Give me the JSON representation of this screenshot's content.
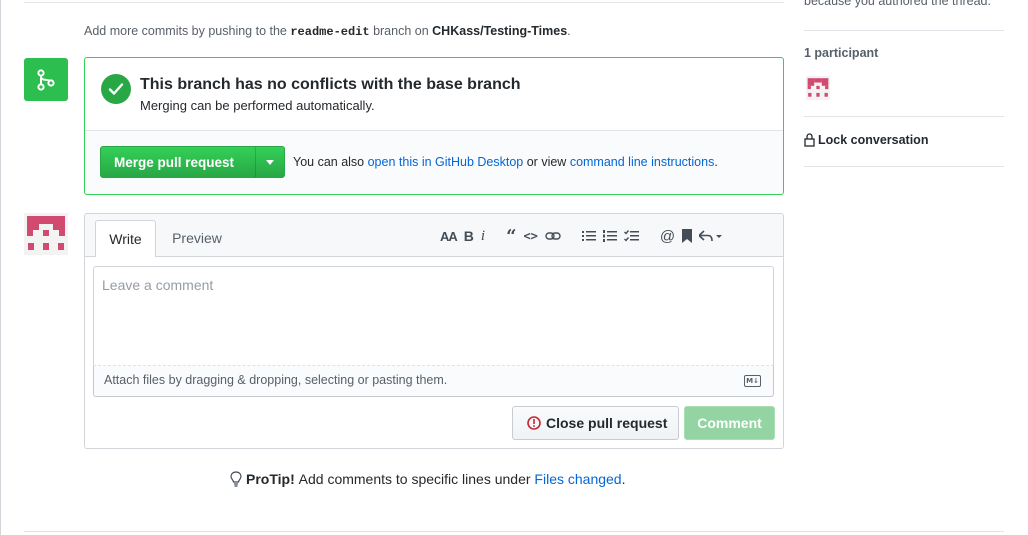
{
  "push_note": {
    "prefix": "Add more commits by pushing to the",
    "branch": "readme-edit",
    "middle": "branch on",
    "repo": "CHKass/Testing-Times",
    "suffix": "."
  },
  "merge": {
    "title": "This branch has no conflicts with the base branch",
    "subtitle": "Merging can be performed automatically.",
    "button_label": "Merge pull request",
    "also_prefix": "You can also",
    "desktop_link": "open this in GitHub Desktop",
    "also_middle": "or view",
    "cli_link": "command line instructions",
    "also_suffix": "."
  },
  "comment": {
    "tab_write": "Write",
    "tab_preview": "Preview",
    "placeholder": "Leave a comment",
    "attach_text": "Attach files by dragging & dropping, selecting or pasting them.",
    "close_button": "Close pull request",
    "comment_button": "Comment",
    "toolbar_icons": [
      "text-size-icon",
      "bold-icon",
      "italic-icon",
      "quote-icon",
      "code-icon",
      "link-icon",
      "unordered-list-icon",
      "ordered-list-icon",
      "task-list-icon",
      "mention-icon",
      "bookmark-icon",
      "reply-icon"
    ]
  },
  "protip": {
    "bold": "ProTip!",
    "text": "Add comments to specific lines under",
    "link": "Files changed",
    "suffix": "."
  },
  "sidebar": {
    "notification_text": "because you authored the thread.",
    "participants": "1 participant",
    "lock": "Lock conversation"
  },
  "colors": {
    "success": "#28a745",
    "link": "#0366d6",
    "avatar": "#d14a6f"
  }
}
